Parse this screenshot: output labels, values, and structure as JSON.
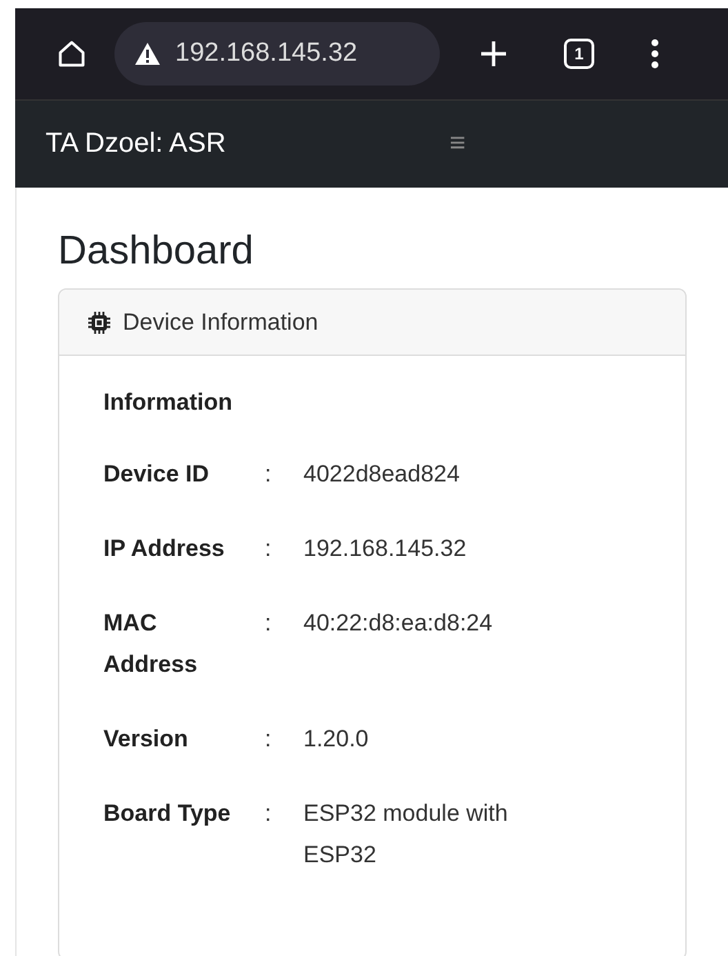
{
  "browser": {
    "url": "192.168.145.32",
    "tab_count": "1"
  },
  "navbar": {
    "title": "TA Dzoel: ASR",
    "toggle": "≡"
  },
  "page": {
    "title": "Dashboard"
  },
  "card": {
    "title": "Device Information",
    "section": "Information",
    "rows": [
      {
        "label": "Device ID",
        "separator": ":",
        "value": "4022d8ead824"
      },
      {
        "label": "IP Address",
        "separator": ":",
        "value": "192.168.145.32"
      },
      {
        "label": "MAC Address",
        "separator": ":",
        "value": "40:22:d8:ea:d8:24"
      },
      {
        "label": "Version",
        "separator": ":",
        "value": "1.20.0"
      },
      {
        "label": "Board Type",
        "separator": ":",
        "value": "ESP32 module with ESP32"
      }
    ]
  }
}
